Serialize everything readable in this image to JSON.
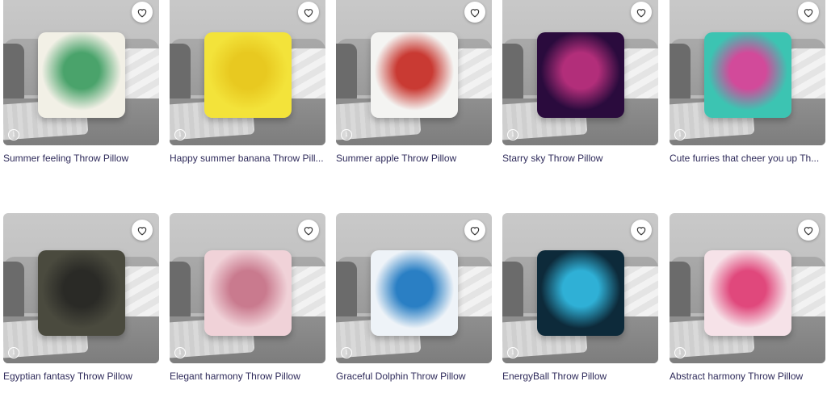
{
  "products": [
    {
      "title": "Summer feeling Throw Pillow",
      "pillow_colors": [
        "#f2f0e6",
        "#4aa36b"
      ]
    },
    {
      "title": "Happy summer banana Throw Pill...",
      "pillow_colors": [
        "#f3e33a",
        "#e8c920"
      ]
    },
    {
      "title": "Summer apple Throw Pillow",
      "pillow_colors": [
        "#f4f4f2",
        "#c93a33"
      ]
    },
    {
      "title": "Starry sky Throw Pillow",
      "pillow_colors": [
        "#2a0b3d",
        "#b22e7a"
      ]
    },
    {
      "title": "Cute furries that cheer you up Th...",
      "pillow_colors": [
        "#3cc4b2",
        "#d24a9a"
      ]
    },
    {
      "title": "Egyptian fantasy Throw Pillow",
      "pillow_colors": [
        "#4a4a3e",
        "#2a2a26"
      ]
    },
    {
      "title": "Elegant harmony Throw Pillow",
      "pillow_colors": [
        "#f0d2d8",
        "#c97a8e"
      ]
    },
    {
      "title": "Graceful Dolphin Throw Pillow",
      "pillow_colors": [
        "#eef3f8",
        "#2a7fc4"
      ]
    },
    {
      "title": "EnergyBall Throw Pillow",
      "pillow_colors": [
        "#0d2a3a",
        "#2fb0d6"
      ]
    },
    {
      "title": "Abstract harmony Throw Pillow",
      "pillow_colors": [
        "#f6e2e8",
        "#e0487c"
      ]
    }
  ],
  "icons": {
    "favorite": "heart-icon",
    "info": "info-icon"
  },
  "info_glyph": "i",
  "colors": {
    "title_text": "#2e2a5a",
    "card_bg": "#ffffff"
  }
}
